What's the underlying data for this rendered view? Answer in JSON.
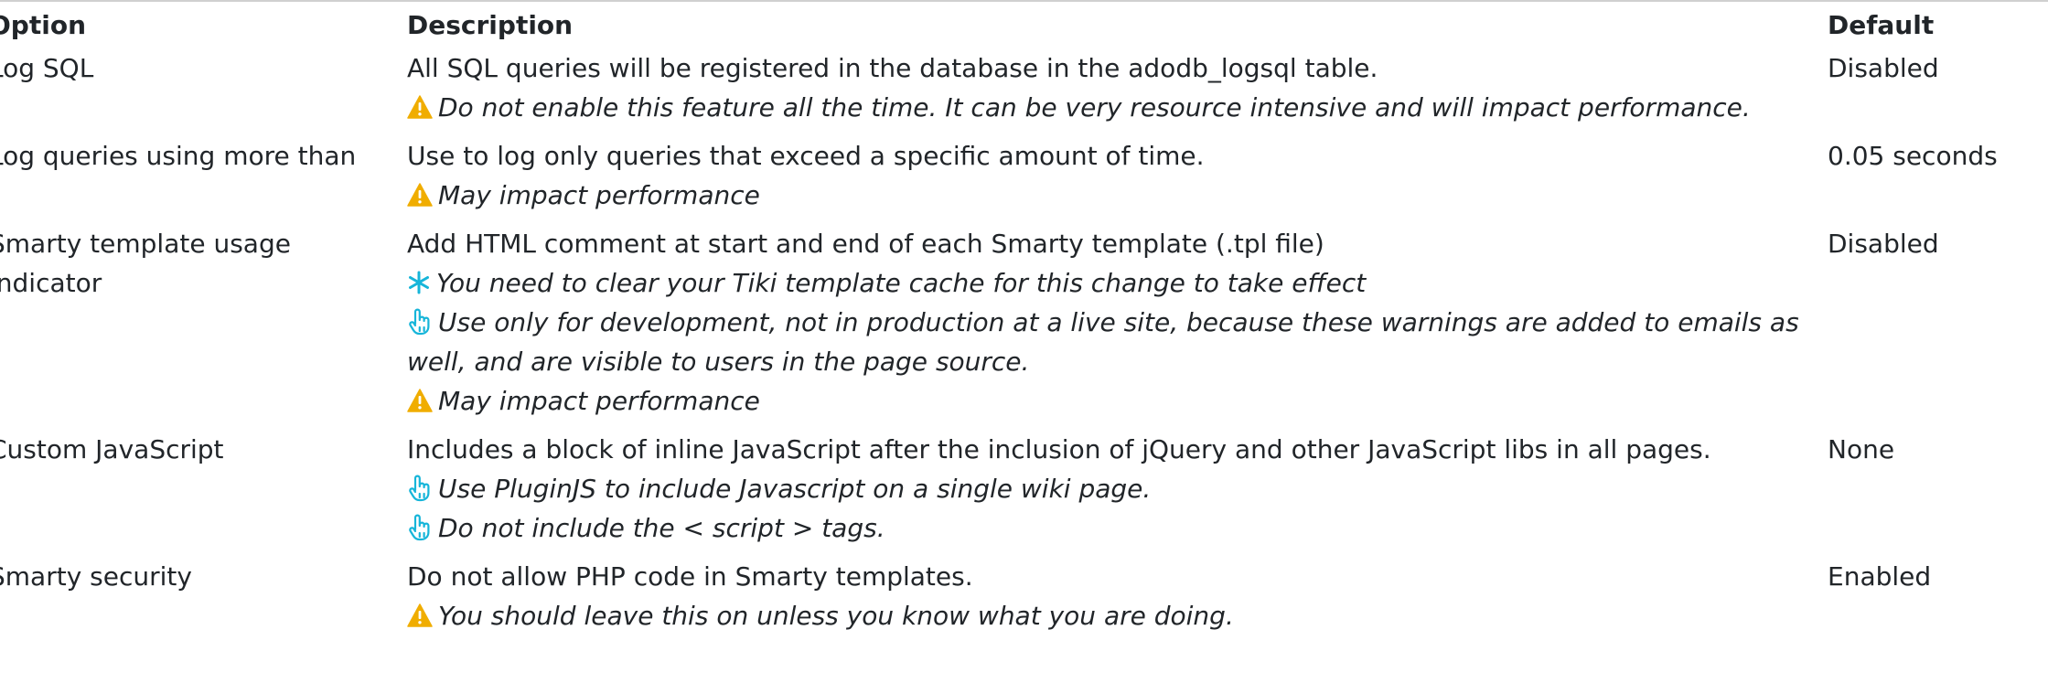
{
  "colors": {
    "warning": "#f0ad00",
    "info": "#16b5d9",
    "text": "#212529"
  },
  "headers": {
    "option": "Option",
    "description": "Description",
    "default": "Default"
  },
  "rows": [
    {
      "option": "Log SQL",
      "description": "All SQL queries will be registered in the database in the adodb_logsql table.",
      "notes": [
        {
          "icon": "warning-icon",
          "text": "Do not enable this feature all the time. It can be very resource intensive and will impact performance."
        }
      ],
      "default": "Disabled"
    },
    {
      "option": "Log queries using more than",
      "description": "Use to log only queries that exceed a specific amount of time.",
      "notes": [
        {
          "icon": "warning-icon",
          "text": "May impact performance"
        }
      ],
      "default": "0.05 seconds"
    },
    {
      "option": "Smarty template usage indicator",
      "description": "Add HTML comment at start and end of each Smarty template (.tpl file)",
      "notes": [
        {
          "icon": "asterisk-icon",
          "text": "You need to clear your Tiki template cache for this change to take effect"
        },
        {
          "icon": "pointing-hand-icon",
          "text": "Use only for development, not in production at a live site, because these warnings are added to emails as well, and are visible to users in the page source."
        },
        {
          "icon": "warning-icon",
          "text": "May impact performance"
        }
      ],
      "default": "Disabled"
    },
    {
      "option": "Custom JavaScript",
      "description": "Includes a block of inline JavaScript after the inclusion of jQuery and other JavaScript libs in all pages.",
      "notes": [
        {
          "icon": "pointing-hand-icon",
          "text": "Use PluginJS to include Javascript on a single wiki page."
        },
        {
          "icon": "pointing-hand-icon",
          "text": "Do not include the < script > tags."
        }
      ],
      "default": "None"
    },
    {
      "option": "Smarty security",
      "description": "Do not allow PHP code in Smarty templates.",
      "notes": [
        {
          "icon": "warning-icon",
          "text": "You should leave this on unless you know what you are doing."
        }
      ],
      "default": "Enabled"
    }
  ]
}
